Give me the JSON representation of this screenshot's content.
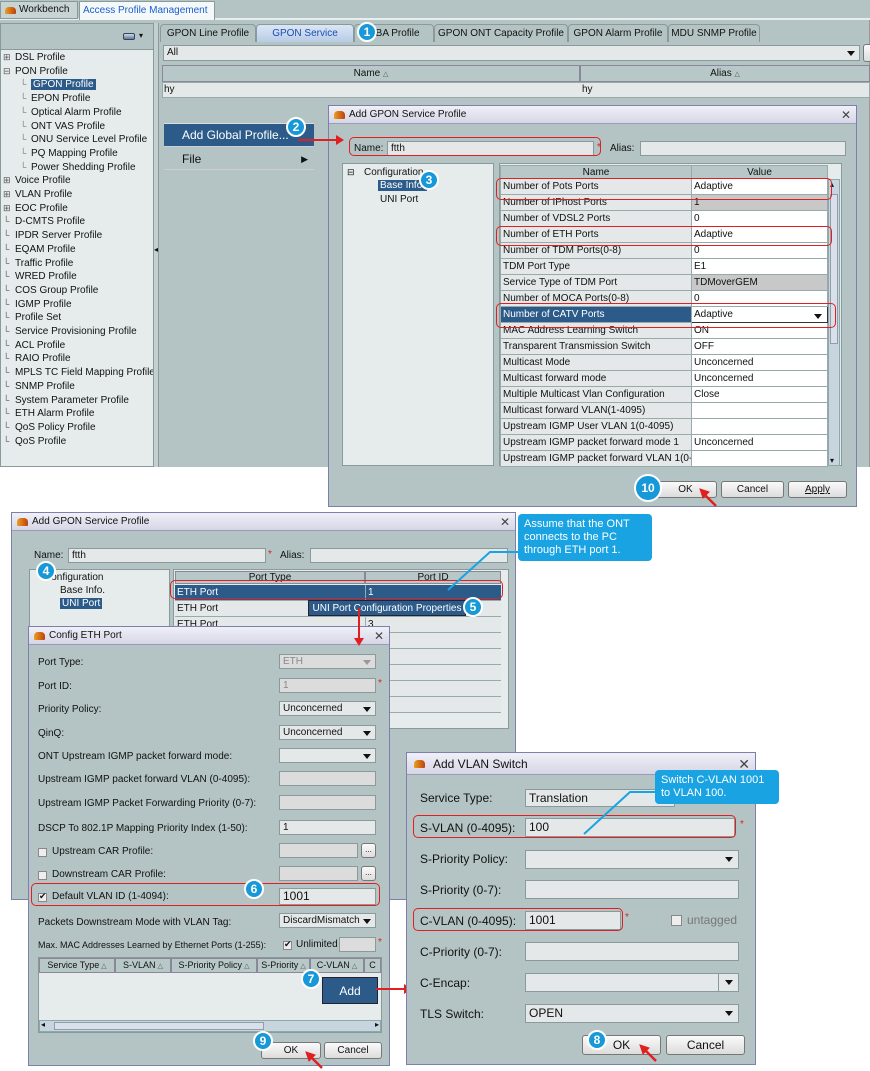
{
  "app": {
    "tabs": [
      {
        "label": "Workbench",
        "active": false
      },
      {
        "label": "Access Profile Management",
        "active": true,
        "closable": true
      }
    ]
  },
  "sidebar": {
    "tree": [
      {
        "label": "DSL Profile",
        "expandable": true
      },
      {
        "label": "PON Profile",
        "expanded": true,
        "children": [
          {
            "label": "GPON Profile",
            "selected": true
          },
          {
            "label": "EPON Profile"
          },
          {
            "label": "Optical Alarm Profile"
          },
          {
            "label": "ONT VAS Profile"
          },
          {
            "label": "ONU Service Level Profile"
          },
          {
            "label": "PQ Mapping Profile"
          },
          {
            "label": "Power Shedding Profile"
          }
        ]
      },
      {
        "label": "Voice Profile",
        "expandable": true
      },
      {
        "label": "VLAN Profile",
        "expandable": true
      },
      {
        "label": "EOC Profile",
        "expandable": true
      },
      {
        "label": "D-CMTS Profile"
      },
      {
        "label": "IPDR Server Profile"
      },
      {
        "label": "EQAM Profile"
      },
      {
        "label": "Traffic Profile"
      },
      {
        "label": "WRED Profile"
      },
      {
        "label": "COS Group Profile"
      },
      {
        "label": "IGMP Profile"
      },
      {
        "label": "Profile Set"
      },
      {
        "label": "Service Provisioning Profile"
      },
      {
        "label": "ACL Profile"
      },
      {
        "label": "RAIO Profile"
      },
      {
        "label": "MPLS TC Field Mapping Profile"
      },
      {
        "label": "SNMP Profile"
      },
      {
        "label": "System Parameter Profile"
      },
      {
        "label": "ETH Alarm Profile"
      },
      {
        "label": "QoS Policy Profile"
      },
      {
        "label": "QoS Profile"
      }
    ]
  },
  "main": {
    "profile_tabs": [
      "GPON Line Profile",
      "GPON Service Profile",
      "DBA Profile",
      "GPON ONT Capacity Profile",
      "GPON Alarm Profile",
      "MDU SNMP Profile"
    ],
    "active_tab": "GPON Service Profile",
    "filter": "All",
    "columns": [
      "Name",
      "Alias"
    ],
    "rows": [
      [
        "hy",
        "hy"
      ]
    ],
    "context_menu": {
      "items": [
        {
          "label": "Add Global Profile...",
          "highlighted": true
        },
        {
          "label": "File",
          "submenu": true
        }
      ]
    }
  },
  "dialog_base": {
    "title": "Add GPON Service Profile",
    "name_label": "Name:",
    "name_value": "ftth",
    "alias_label": "Alias:",
    "alias_value": "",
    "tree": {
      "root": "Configuration",
      "children": [
        "Base Info.",
        "UNI Port"
      ],
      "selected": "Base Info."
    },
    "columns": [
      "Name",
      "Value"
    ],
    "rows": [
      [
        "Number of Pots Ports",
        "Adaptive"
      ],
      [
        "Number of IPhost Ports",
        "1"
      ],
      [
        "Number of VDSL2 Ports",
        "0"
      ],
      [
        "Number of ETH Ports",
        "Adaptive"
      ],
      [
        "Number of TDM Ports(0-8)",
        "0"
      ],
      [
        "TDM Port Type",
        "E1"
      ],
      [
        "Service Type of TDM Port",
        "TDMoverGEM"
      ],
      [
        "Number of MOCA Ports(0-8)",
        "0"
      ],
      [
        "Number of CATV Ports",
        "Adaptive"
      ],
      [
        "MAC Address Learning Switch",
        "ON"
      ],
      [
        "Transparent Transmission Switch",
        "OFF"
      ],
      [
        "Multicast Mode",
        "Unconcerned"
      ],
      [
        "Multicast forward mode",
        "Unconcerned"
      ],
      [
        "Multiple Multicast Vlan Configuration",
        "Close"
      ],
      [
        "Multicast forward VLAN(1-4095)",
        ""
      ],
      [
        "Upstream IGMP User VLAN 1(0-4095)",
        ""
      ],
      [
        "Upstream IGMP packet forward mode 1",
        "Unconcerned"
      ],
      [
        "Upstream IGMP packet forward VLAN 1(0-4...",
        ""
      ]
    ],
    "buttons": {
      "ok": "OK",
      "cancel": "Cancel",
      "apply": "Apply"
    }
  },
  "dialog_uni": {
    "title": "Add GPON Service Profile",
    "name_label": "Name:",
    "name_value": "ftth",
    "alias_label": "Alias:",
    "tree": {
      "root": "Configuration",
      "children": [
        "Base Info.",
        "UNI Port"
      ],
      "selected": "UNI Port"
    },
    "columns": [
      "Port Type",
      "Port ID"
    ],
    "rows": [
      [
        "ETH Port",
        "1"
      ],
      [
        "ETH Port",
        ""
      ],
      [
        "ETH Port",
        "3"
      ]
    ],
    "popup_menu": "UNI Port Configuration Properties"
  },
  "dialog_eth": {
    "title": "Config ETH Port",
    "fields": {
      "port_type": {
        "label": "Port Type:",
        "value": "ETH"
      },
      "port_id": {
        "label": "Port ID:",
        "value": "1"
      },
      "priority_policy": {
        "label": "Priority Policy:",
        "value": "Unconcerned"
      },
      "qinq": {
        "label": "QinQ:",
        "value": "Unconcerned"
      },
      "igmp_mode": {
        "label": "ONT Upstream IGMP packet forward mode:",
        "value": ""
      },
      "igmp_vlan": {
        "label": "Upstream IGMP packet forward VLAN (0-4095):",
        "value": ""
      },
      "igmp_priority": {
        "label": "Upstream IGMP Packet Forwarding Priority (0-7):",
        "value": ""
      },
      "dscp": {
        "label": "DSCP To 802.1P Mapping Priority Index (1-50):",
        "value": "1"
      },
      "up_car": {
        "label": "Upstream CAR Profile:",
        "checked": false,
        "value": ""
      },
      "down_car": {
        "label": "Downstream CAR Profile:",
        "checked": false,
        "value": ""
      },
      "default_vlan": {
        "label": "Default VLAN ID (1-4094):",
        "checked": true,
        "value": "1001"
      },
      "downstream_mode": {
        "label": "Packets Downstream Mode with VLAN Tag:",
        "value": "DiscardMismatch"
      },
      "max_mac": {
        "label": "Max. MAC Addresses Learned by Ethernet Ports (1-255):",
        "unlimited_label": "Unlimited",
        "unlimited": true,
        "value": ""
      }
    },
    "columns": [
      "Service Type",
      "S-VLAN",
      "S-Priority Policy",
      "S-Priority",
      "C-VLAN",
      "C"
    ],
    "add_button": "Add",
    "buttons": {
      "ok": "OK",
      "cancel": "Cancel"
    },
    "browse": "..."
  },
  "dialog_vlan": {
    "title": "Add VLAN Switch",
    "fields": {
      "service_type": {
        "label": "Service Type:",
        "value": "Translation"
      },
      "s_vlan": {
        "label": "S-VLAN (0-4095):",
        "value": "100"
      },
      "s_priority_policy": {
        "label": "S-Priority Policy:",
        "value": ""
      },
      "s_priority": {
        "label": "S-Priority (0-7):",
        "value": ""
      },
      "c_vlan": {
        "label": "C-VLAN (0-4095):",
        "value": "1001"
      },
      "untagged": {
        "label": "untagged",
        "checked": false
      },
      "c_priority": {
        "label": "C-Priority (0-7):",
        "value": ""
      },
      "c_encap": {
        "label": "C-Encap:",
        "value": ""
      },
      "tls": {
        "label": "TLS Switch:",
        "value": "OPEN"
      }
    },
    "buttons": {
      "ok": "OK",
      "cancel": "Cancel"
    }
  },
  "annotations": {
    "callout_eth": "Assume that the ONT connects to the PC through ETH port 1.",
    "callout_vlan": "Switch C-VLAN 1001 to VLAN 100.",
    "steps": [
      "1",
      "2",
      "3",
      "4",
      "5",
      "6",
      "7",
      "8",
      "9",
      "10"
    ],
    "required_mark": "*"
  }
}
